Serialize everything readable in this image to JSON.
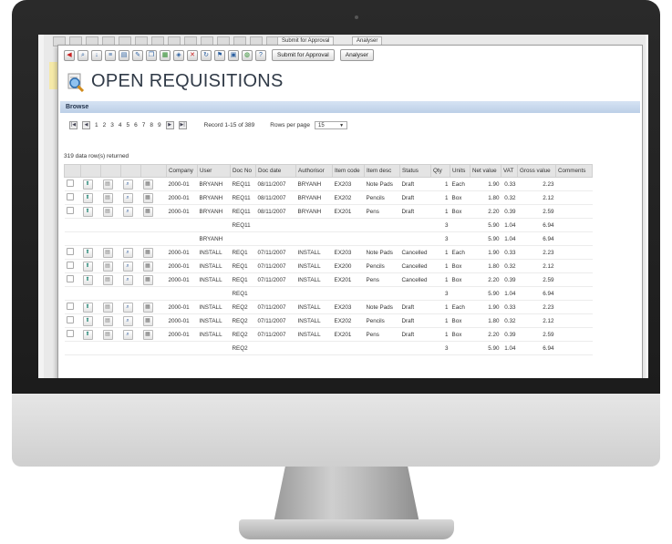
{
  "app": {
    "title": "OPEN REQUISITIONS",
    "browse_label": "Browse",
    "submit_button": "Submit for Approval",
    "analyser_button": "Analyser",
    "bg_submit_button": "Submit for Approval",
    "bg_analyser_button": "Analyser"
  },
  "pager": {
    "first": "|◀",
    "prev": "◀",
    "pages": [
      "1",
      "2",
      "3",
      "4",
      "5",
      "6",
      "7",
      "8",
      "9"
    ],
    "next": "▶",
    "last": "▶|",
    "record_text": "Record 1-15 of 389",
    "rows_per_page_label": "Rows per page",
    "rows_per_page_value": "15"
  },
  "rows_returned": "319 data row(s) returned",
  "table": {
    "headers": [
      "Company",
      "User",
      "Doc No",
      "Doc date",
      "Authorisor",
      "Item code",
      "Item desc",
      "Status",
      "Qty",
      "Units",
      "Net value",
      "VAT",
      "Gross value",
      "Comments"
    ],
    "rows": [
      {
        "type": "item",
        "company": "2000-01",
        "user": "BRYANH",
        "doc": "REQ11",
        "date": "08/11/2007",
        "auth": "BRYANH",
        "code": "EX203",
        "desc": "Note Pads",
        "status": "Draft",
        "qty": "1",
        "units": "Each",
        "net": "1.90",
        "vat": "0.33",
        "gross": "2.23"
      },
      {
        "type": "item",
        "company": "2000-01",
        "user": "BRYANH",
        "doc": "REQ11",
        "date": "08/11/2007",
        "auth": "BRYANH",
        "code": "EX202",
        "desc": "Pencils",
        "status": "Draft",
        "qty": "1",
        "units": "Box",
        "net": "1.80",
        "vat": "0.32",
        "gross": "2.12"
      },
      {
        "type": "item",
        "company": "2000-01",
        "user": "BRYANH",
        "doc": "REQ11",
        "date": "08/11/2007",
        "auth": "BRYANH",
        "code": "EX201",
        "desc": "Pens",
        "status": "Draft",
        "qty": "1",
        "units": "Box",
        "net": "2.20",
        "vat": "0.39",
        "gross": "2.59"
      },
      {
        "type": "doc",
        "doc": "REQ11",
        "qty": "3",
        "net": "5.90",
        "vat": "1.04",
        "gross": "6.94"
      },
      {
        "type": "user",
        "user": "BRYANH",
        "qty": "3",
        "net": "5.90",
        "vat": "1.04",
        "gross": "6.94"
      },
      {
        "type": "item",
        "company": "2000-01",
        "user": "INSTALL",
        "doc": "REQ1",
        "date": "07/11/2007",
        "auth": "INSTALL",
        "code": "EX203",
        "desc": "Note Pads",
        "status": "Cancelled",
        "qty": "1",
        "units": "Each",
        "net": "1.90",
        "vat": "0.33",
        "gross": "2.23"
      },
      {
        "type": "item",
        "company": "2000-01",
        "user": "INSTALL",
        "doc": "REQ1",
        "date": "07/11/2007",
        "auth": "INSTALL",
        "code": "EX200",
        "desc": "Pencils",
        "status": "Cancelled",
        "qty": "1",
        "units": "Box",
        "net": "1.80",
        "vat": "0.32",
        "gross": "2.12"
      },
      {
        "type": "item",
        "company": "2000-01",
        "user": "INSTALL",
        "doc": "REQ1",
        "date": "07/11/2007",
        "auth": "INSTALL",
        "code": "EX201",
        "desc": "Pens",
        "status": "Cancelled",
        "qty": "1",
        "units": "Box",
        "net": "2.20",
        "vat": "0.39",
        "gross": "2.59"
      },
      {
        "type": "doc",
        "doc": "REQ1",
        "qty": "3",
        "net": "5.90",
        "vat": "1.04",
        "gross": "6.94"
      },
      {
        "type": "item",
        "company": "2000-01",
        "user": "INSTALL",
        "doc": "REQ2",
        "date": "07/11/2007",
        "auth": "INSTALL",
        "code": "EX203",
        "desc": "Note Pads",
        "status": "Draft",
        "qty": "1",
        "units": "Each",
        "net": "1.90",
        "vat": "0.33",
        "gross": "2.23"
      },
      {
        "type": "item",
        "company": "2000-01",
        "user": "INSTALL",
        "doc": "REQ2",
        "date": "07/11/2007",
        "auth": "INSTALL",
        "code": "EX202",
        "desc": "Pencils",
        "status": "Draft",
        "qty": "1",
        "units": "Box",
        "net": "1.80",
        "vat": "0.32",
        "gross": "2.12"
      },
      {
        "type": "item",
        "company": "2000-01",
        "user": "INSTALL",
        "doc": "REQ2",
        "date": "07/11/2007",
        "auth": "INSTALL",
        "code": "EX201",
        "desc": "Pens",
        "status": "Draft",
        "qty": "1",
        "units": "Box",
        "net": "2.20",
        "vat": "0.39",
        "gross": "2.59"
      },
      {
        "type": "doc",
        "doc": "REQ2",
        "qty": "3",
        "net": "5.90",
        "vat": "1.04",
        "gross": "6.94"
      }
    ]
  },
  "icons": {
    "row_icons": [
      "pin-icon",
      "document-icon",
      "magnify-icon",
      "image-icon"
    ],
    "toolbar_icons": [
      "back-icon",
      "search-icon",
      "sort-icon",
      "list-icon",
      "print-icon",
      "edit-icon",
      "copy-icon",
      "export-icon",
      "attach-icon",
      "cancel-icon",
      "refresh-icon",
      "flag-icon",
      "report-icon",
      "globe-icon",
      "help-icon"
    ]
  },
  "colors": {
    "browse_bar": "#c9d9ee",
    "title": "#303a47"
  }
}
